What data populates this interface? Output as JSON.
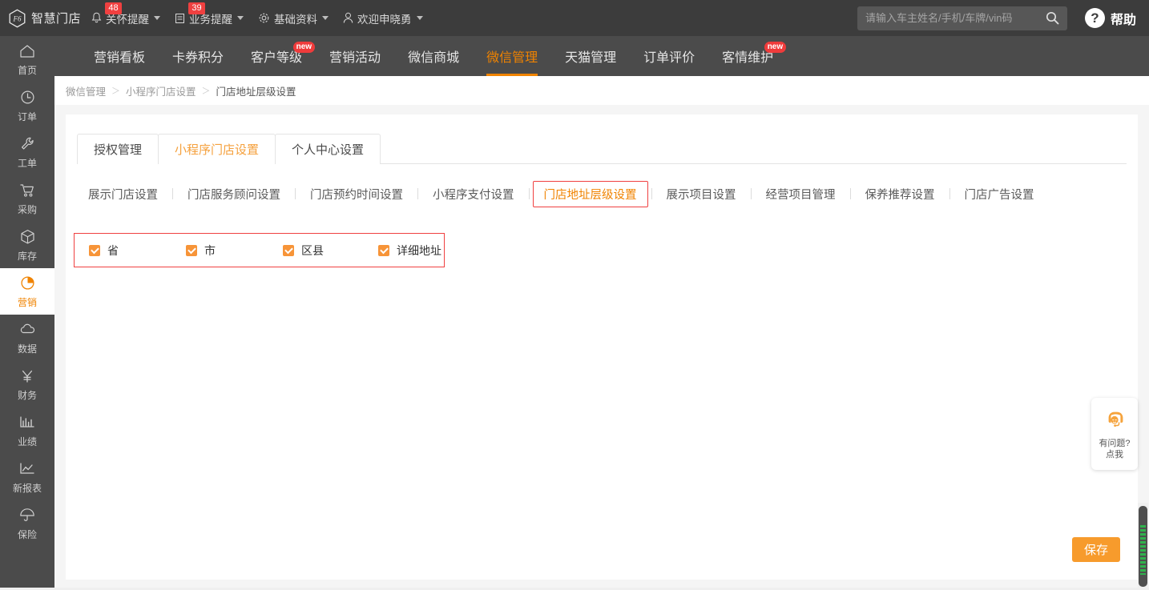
{
  "brand": {
    "logo_icon": "hexagon-f6-logo-icon",
    "logo_mark_text": "F6",
    "name": "智慧门店"
  },
  "topbar": {
    "menus": [
      {
        "icon": "bell-icon",
        "label": "关怀提醒",
        "badge": "48",
        "caret": true
      },
      {
        "icon": "document-icon",
        "label": "业务提醒",
        "badge": "39",
        "caret": true
      },
      {
        "icon": "gear-icon",
        "label": "基础资料",
        "badge": "",
        "caret": true
      },
      {
        "icon": "user-icon",
        "label": "欢迎申晓勇",
        "badge": "",
        "caret": true
      }
    ],
    "search": {
      "placeholder": "请输入车主姓名/手机/车牌/vin码",
      "value": "",
      "icon": "search-icon"
    },
    "help": {
      "icon": "question-circle-icon",
      "label": "帮助"
    }
  },
  "sidebar": {
    "items": [
      {
        "icon": "home-icon",
        "label": "首页",
        "active": false
      },
      {
        "icon": "clock-icon",
        "label": "订单",
        "active": false
      },
      {
        "icon": "wrench-icon",
        "label": "工单",
        "active": false
      },
      {
        "icon": "cart-icon",
        "label": "采购",
        "active": false
      },
      {
        "icon": "box-icon",
        "label": "库存",
        "active": false
      },
      {
        "icon": "pie-chart-icon",
        "label": "营销",
        "active": true
      },
      {
        "icon": "cloud-icon",
        "label": "数据",
        "active": false
      },
      {
        "icon": "yen-icon",
        "label": "财务",
        "active": false
      },
      {
        "icon": "bar-chart-icon",
        "label": "业绩",
        "active": false
      },
      {
        "icon": "line-chart-icon",
        "label": "新报表",
        "active": false
      },
      {
        "icon": "umbrella-icon",
        "label": "保险",
        "active": false
      }
    ]
  },
  "secondnav": {
    "items": [
      {
        "label": "营销看板",
        "badge": "",
        "active": false
      },
      {
        "label": "卡券积分",
        "badge": "",
        "active": false
      },
      {
        "label": "客户等级",
        "badge": "new",
        "active": false
      },
      {
        "label": "营销活动",
        "badge": "",
        "active": false
      },
      {
        "label": "微信商城",
        "badge": "",
        "active": false
      },
      {
        "label": "微信管理",
        "badge": "",
        "active": true
      },
      {
        "label": "天猫管理",
        "badge": "",
        "active": false
      },
      {
        "label": "订单评价",
        "badge": "",
        "active": false
      },
      {
        "label": "客情维护",
        "badge": "new",
        "active": false
      }
    ]
  },
  "breadcrumb": {
    "items": [
      "微信管理",
      "小程序门店设置",
      "门店地址层级设置"
    ],
    "separator": "＞"
  },
  "main": {
    "tabs": [
      {
        "label": "授权管理",
        "active": false
      },
      {
        "label": "小程序门店设置",
        "active": true
      },
      {
        "label": "个人中心设置",
        "active": false
      }
    ],
    "subtabs": [
      {
        "label": "展示门店设置",
        "active": false
      },
      {
        "label": "门店服务顾问设置",
        "active": false
      },
      {
        "label": "门店预约时间设置",
        "active": false
      },
      {
        "label": "小程序支付设置",
        "active": false
      },
      {
        "label": "门店地址层级设置",
        "active": true
      },
      {
        "label": "展示项目设置",
        "active": false
      },
      {
        "label": "经营项目管理",
        "active": false
      },
      {
        "label": "保养推荐设置",
        "active": false
      },
      {
        "label": "门店广告设置",
        "active": false
      }
    ],
    "address_levels": [
      {
        "label": "省",
        "checked": true
      },
      {
        "label": "市",
        "checked": true
      },
      {
        "label": "区县",
        "checked": true
      },
      {
        "label": "详细地址",
        "checked": true
      }
    ],
    "save_label": "保存"
  },
  "float_help": {
    "icon": "headset-support-icon",
    "line1": "有问题?",
    "line2": "点我"
  },
  "colors": {
    "accent_orange": "#f08300",
    "button_orange": "#f79b2c",
    "checkbox_orange": "#f79438",
    "highlight_red": "#f04040",
    "badge_red": "#ef3b3b",
    "topbar_dark": "#3c3c3c",
    "sidebar_dark": "#4b4b4b",
    "page_bg": "#f5f5f5",
    "scrollbar_green": "#2fb24c"
  }
}
